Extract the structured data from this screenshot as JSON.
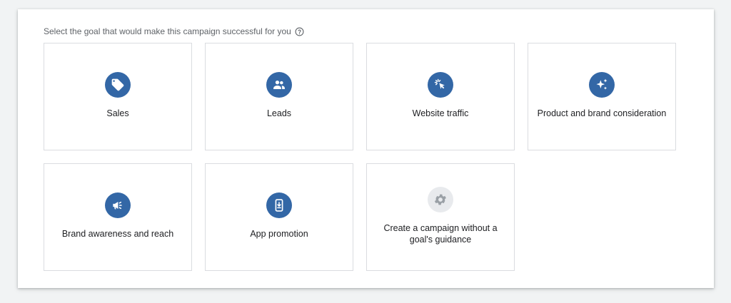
{
  "prompt": {
    "text": "Select the goal that would make this campaign successful for you"
  },
  "goals": [
    {
      "label": "Sales",
      "icon": "tag-icon"
    },
    {
      "label": "Leads",
      "icon": "people-icon"
    },
    {
      "label": "Website traffic",
      "icon": "cursor-click-icon"
    },
    {
      "label": "Product and brand consideration",
      "icon": "sparkle-icon"
    },
    {
      "label": "Brand awareness and reach",
      "icon": "megaphone-icon"
    },
    {
      "label": "App promotion",
      "icon": "phone-download-icon"
    },
    {
      "label_line1": "Create a campaign without a",
      "label_line2": "goal's guidance",
      "icon": "gear-icon"
    }
  ],
  "colors": {
    "accent": "#3367a6",
    "neutral_icon_bg": "#e8eaed",
    "neutral_icon": "#9aa0a6",
    "card_border": "#dadce0"
  }
}
